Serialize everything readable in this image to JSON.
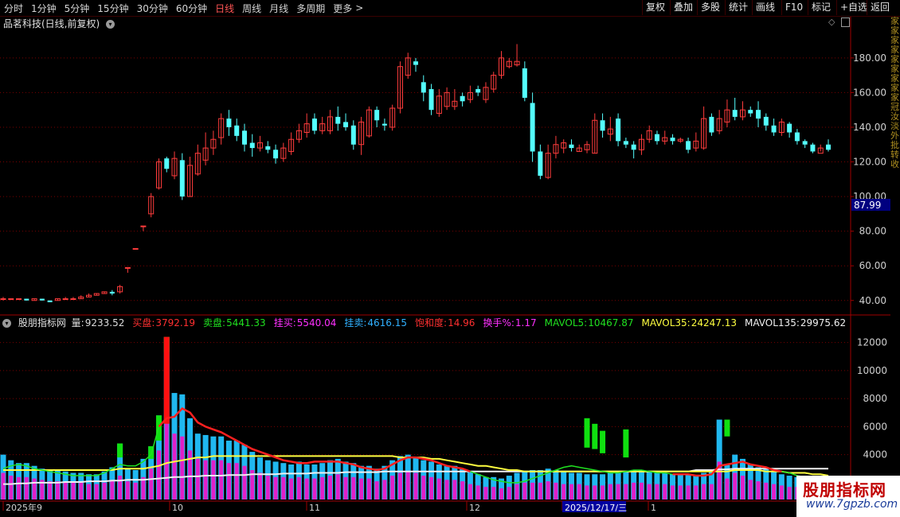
{
  "toolbar": {
    "periods": [
      {
        "label": "分时",
        "active": false
      },
      {
        "label": "1分钟",
        "active": false
      },
      {
        "label": "5分钟",
        "active": false
      },
      {
        "label": "15分钟",
        "active": false
      },
      {
        "label": "30分钟",
        "active": false
      },
      {
        "label": "60分钟",
        "active": false
      },
      {
        "label": "日线",
        "active": true
      },
      {
        "label": "周线",
        "active": false
      },
      {
        "label": "月线",
        "active": false
      },
      {
        "label": "多周期",
        "active": false
      },
      {
        "label": "更多",
        "active": false
      }
    ],
    "more_arrow": ">",
    "right_buttons": [
      "复权",
      "叠加",
      "多股",
      "统计",
      "画线",
      "F10",
      "标记",
      "+自选",
      "返回"
    ]
  },
  "chart_title": "品茗科技(日线,前复权)",
  "price_axis": {
    "ticks": [
      180,
      160,
      140,
      120,
      100,
      80,
      60,
      40
    ],
    "current_label": "87.99",
    "ylim": [
      33,
      196
    ]
  },
  "volume_axis": {
    "ticks": [
      12000,
      10000,
      8000,
      6000,
      4000,
      2000
    ],
    "ylim": [
      800,
      13000
    ]
  },
  "volume_header": {
    "name": "股朋指标网",
    "items": [
      {
        "label": "量:",
        "value": "9233.52",
        "color": "#dcdcdc"
      },
      {
        "label": "买盘:",
        "value": "3792.19",
        "color": "#ff3030"
      },
      {
        "label": "卖盘:",
        "value": "5441.33",
        "color": "#20e020"
      },
      {
        "label": "挂买:",
        "value": "5540.04",
        "color": "#ff30ff"
      },
      {
        "label": "挂卖:",
        "value": "4616.15",
        "color": "#30b0ff"
      },
      {
        "label": "饱和度:",
        "value": "14.96",
        "color": "#ff3030"
      },
      {
        "label": "换手%:",
        "value": "1.17",
        "color": "#ff30ff"
      },
      {
        "label": "MAVOL5:",
        "value": "10467.87",
        "color": "#20e020"
      },
      {
        "label": "MAVOL35:",
        "value": "24247.13",
        "color": "#ffff40"
      },
      {
        "label": "MAVOL135:",
        "value": "29975.62",
        "color": "#f0f0f0"
      }
    ]
  },
  "date_axis": [
    {
      "label": "2025年9",
      "highlight": false
    },
    {
      "label": "10",
      "highlight": false
    },
    {
      "label": "11",
      "highlight": false
    },
    {
      "label": "12",
      "highlight": false
    },
    {
      "label": "2025/12/17/三",
      "highlight": true
    },
    {
      "label": "1",
      "highlight": false
    }
  ],
  "watermark": {
    "title": "股朋指标网",
    "url": "www.7gpzb.com"
  },
  "colors": {
    "up": "#ff3c3c",
    "down": "#54ffff",
    "grid": "#7a0000",
    "ma5": "#20e020",
    "ma35": "#ffff40",
    "ma135": "#f0f0f0",
    "buy": "#ff1010",
    "sell": "#10e010",
    "magenta": "#e020c8",
    "cyan": "#20b8f0"
  },
  "chart_data": {
    "type": "candlestick",
    "price_candles": [
      [
        41,
        41,
        40,
        42
      ],
      [
        41,
        41,
        41,
        41
      ],
      [
        41,
        41,
        41,
        41
      ],
      [
        41,
        40,
        40,
        41
      ],
      [
        40,
        41,
        40,
        41
      ],
      [
        41,
        40,
        40,
        41
      ],
      [
        40,
        39,
        39,
        40
      ],
      [
        40,
        41,
        40,
        41
      ],
      [
        41,
        41,
        41,
        42
      ],
      [
        41,
        41,
        41,
        42
      ],
      [
        41,
        42,
        41,
        43
      ],
      [
        42,
        43,
        42,
        44
      ],
      [
        43,
        44,
        43,
        44
      ],
      [
        44,
        45,
        44,
        45
      ],
      [
        45,
        44,
        43,
        46
      ],
      [
        45,
        48,
        44,
        49
      ],
      [
        59,
        59,
        56,
        59
      ],
      [
        70,
        70,
        70,
        70
      ],
      [
        83,
        83,
        80,
        83
      ],
      [
        90,
        100,
        88,
        102
      ],
      [
        105,
        120,
        104,
        122
      ],
      [
        122,
        116,
        114,
        123
      ],
      [
        112,
        122,
        110,
        126
      ],
      [
        121,
        100,
        98,
        125
      ],
      [
        100,
        118,
        100,
        123
      ],
      [
        113,
        125,
        112,
        130
      ],
      [
        121,
        128,
        118,
        137
      ],
      [
        128,
        133,
        124,
        138
      ],
      [
        134,
        145,
        130,
        148
      ],
      [
        145,
        140,
        135,
        150
      ],
      [
        141,
        135,
        132,
        145
      ],
      [
        138,
        130,
        126,
        142
      ],
      [
        131,
        128,
        123,
        136
      ],
      [
        128,
        131,
        126,
        135
      ],
      [
        129,
        127,
        125,
        132
      ],
      [
        127,
        122,
        119,
        130
      ],
      [
        122,
        128,
        120,
        131
      ],
      [
        126,
        133,
        124,
        137
      ],
      [
        133,
        138,
        131,
        142
      ],
      [
        137,
        142,
        134,
        148
      ],
      [
        145,
        138,
        136,
        148
      ],
      [
        138,
        142,
        136,
        146
      ],
      [
        138,
        146,
        136,
        150
      ],
      [
        146,
        142,
        138,
        152
      ],
      [
        143,
        140,
        138,
        148
      ],
      [
        141,
        130,
        127,
        144
      ],
      [
        130,
        143,
        124,
        146
      ],
      [
        135,
        150,
        134,
        152
      ],
      [
        150,
        144,
        140,
        152
      ],
      [
        142,
        141,
        138,
        145
      ],
      [
        140,
        151,
        138,
        153
      ],
      [
        151,
        175,
        148,
        178
      ],
      [
        170,
        180,
        168,
        183
      ],
      [
        178,
        176,
        172,
        180
      ],
      [
        166,
        160,
        155,
        170
      ],
      [
        162,
        150,
        147,
        165
      ],
      [
        148,
        158,
        146,
        162
      ],
      [
        152,
        160,
        150,
        163
      ],
      [
        152,
        155,
        150,
        162
      ],
      [
        158,
        155,
        152,
        160
      ],
      [
        156,
        160,
        154,
        164
      ],
      [
        162,
        160,
        158,
        164
      ],
      [
        156,
        163,
        154,
        166
      ],
      [
        162,
        170,
        160,
        172
      ],
      [
        170,
        180,
        168,
        184
      ],
      [
        175,
        178,
        174,
        180
      ],
      [
        176,
        178,
        175,
        188
      ],
      [
        174,
        157,
        155,
        178
      ],
      [
        154,
        126,
        120,
        160
      ],
      [
        126,
        112,
        110,
        130
      ],
      [
        111,
        125,
        110,
        130
      ],
      [
        125,
        130,
        122,
        135
      ],
      [
        128,
        131,
        125,
        133
      ],
      [
        130,
        128,
        126,
        133
      ],
      [
        126,
        128,
        126,
        130
      ],
      [
        127,
        130,
        125,
        132
      ],
      [
        125,
        144,
        125,
        148
      ],
      [
        144,
        138,
        134,
        148
      ],
      [
        136,
        139,
        132,
        146
      ],
      [
        145,
        132,
        129,
        148
      ],
      [
        132,
        130,
        128,
        134
      ],
      [
        130,
        127,
        122,
        132
      ],
      [
        127,
        133,
        124,
        136
      ],
      [
        133,
        138,
        131,
        141
      ],
      [
        136,
        132,
        130,
        138
      ],
      [
        132,
        134,
        130,
        138
      ],
      [
        134,
        132,
        130,
        136
      ],
      [
        132,
        133,
        131,
        134
      ],
      [
        132,
        127,
        125,
        134
      ],
      [
        128,
        132,
        126,
        137
      ],
      [
        128,
        145,
        127,
        152
      ],
      [
        146,
        137,
        135,
        148
      ],
      [
        138,
        145,
        136,
        150
      ],
      [
        143,
        150,
        140,
        156
      ],
      [
        150,
        146,
        144,
        157
      ],
      [
        146,
        150,
        144,
        155
      ],
      [
        150,
        148,
        146,
        152
      ],
      [
        150,
        145,
        140,
        155
      ],
      [
        146,
        141,
        138,
        148
      ],
      [
        141,
        137,
        135,
        145
      ],
      [
        137,
        143,
        135,
        145
      ],
      [
        142,
        137,
        134,
        143
      ],
      [
        137,
        132,
        130,
        139
      ],
      [
        132,
        130,
        128,
        133
      ],
      [
        130,
        126,
        125,
        131
      ],
      [
        125,
        128,
        126,
        130
      ],
      [
        130,
        127,
        126,
        133
      ]
    ],
    "volume_bars": {
      "totals": [
        4000,
        3600,
        3400,
        3400,
        3200,
        3000,
        2900,
        2900,
        2800,
        2700,
        2700,
        2600,
        2600,
        2800,
        3100,
        4800,
        3000,
        2900,
        3700,
        4600,
        6800,
        12400,
        8400,
        8300,
        6600,
        5500,
        5400,
        5300,
        5300,
        5000,
        5000,
        4700,
        4200,
        3800,
        3600,
        3500,
        3400,
        3300,
        3500,
        3300,
        3300,
        3400,
        3600,
        3700,
        3500,
        3400,
        3200,
        3200,
        3000,
        3200,
        3600,
        3900,
        4000,
        3800,
        3600,
        3500,
        3300,
        3200,
        3200,
        3000,
        2800,
        2600,
        2400,
        2400,
        2300,
        2500,
        2700,
        2800,
        2900,
        2900,
        3000,
        2900,
        2800,
        2700,
        2700,
        2600,
        2600,
        2600,
        2700,
        2800,
        2800,
        2900,
        2900,
        2800,
        2700,
        2700,
        2600,
        2600,
        2600,
        2500,
        2700,
        2800,
        6500,
        3300,
        4000,
        3700,
        3300,
        3100,
        3000,
        2800,
        2600,
        2500,
        2400,
        2300,
        2200,
        2100,
        2000
      ],
      "magenta": [
        2700,
        2500,
        2400,
        2400,
        2300,
        2200,
        2100,
        2100,
        2000,
        2000,
        2000,
        1900,
        1900,
        2000,
        2200,
        2500,
        2100,
        2000,
        2400,
        3000,
        4300,
        6200,
        5500,
        5300,
        4300,
        3700,
        3600,
        3600,
        3600,
        3400,
        3400,
        3200,
        2900,
        2700,
        2500,
        2400,
        2400,
        2300,
        2400,
        2300,
        2300,
        2400,
        2500,
        2600,
        2400,
        2400,
        2300,
        2300,
        2100,
        2200,
        2500,
        2700,
        2800,
        2700,
        2500,
        2400,
        2300,
        2200,
        2200,
        2100,
        1900,
        1800,
        1700,
        1700,
        1600,
        1700,
        1900,
        2000,
        2000,
        2000,
        2100,
        2000,
        1900,
        1900,
        1900,
        1800,
        1800,
        1800,
        1900,
        1900,
        1900,
        2000,
        2000,
        1900,
        1900,
        1900,
        1800,
        1800,
        1800,
        1800,
        1900,
        1900,
        3500,
        2300,
        2700,
        2500,
        2200,
        2100,
        2000,
        1900,
        1800,
        1700,
        1700,
        1600,
        1500,
        1500,
        1400
      ],
      "red_segments": [
        [
          0,
          0
        ],
        [
          0,
          0
        ],
        [
          0,
          0
        ],
        [
          0,
          0
        ],
        [
          0,
          0
        ],
        [
          0,
          0
        ],
        [
          0,
          0
        ],
        [
          0,
          0
        ],
        [
          0,
          0
        ],
        [
          0,
          0
        ],
        [
          0,
          0
        ],
        [
          0,
          0
        ],
        [
          0,
          0
        ],
        [
          0,
          0
        ],
        [
          0,
          0
        ],
        [
          0,
          0
        ],
        [
          0,
          0
        ],
        [
          0,
          0
        ],
        [
          0,
          0
        ],
        [
          0,
          0
        ],
        [
          0,
          0
        ],
        [
          6200,
          12400
        ],
        [
          0,
          0
        ]
      ],
      "green_top": {
        "15": [
          3800,
          4800
        ],
        "19": [
          3700,
          4600
        ],
        "20": [
          5000,
          6800
        ],
        "21": [
          11300,
          12400
        ],
        "75": [
          4500,
          6600
        ],
        "76": [
          4400,
          6200
        ],
        "77": [
          4100,
          5700
        ],
        "80": [
          3800,
          5800
        ],
        "93": [
          5300,
          6500
        ]
      }
    },
    "ma5": [
      3000,
      3200,
      3300,
      3200,
      3000,
      2900,
      2800,
      2700,
      2600,
      2500,
      2500,
      2500,
      2500,
      2700,
      3000,
      3300,
      3200,
      3200,
      3500,
      4000,
      6000,
      6600,
      6700,
      7300,
      7000,
      6300,
      6000,
      5800,
      5600,
      5300,
      5000,
      4700,
      4400,
      4200,
      4000,
      3800,
      3600,
      3500,
      3400,
      3400,
      3500,
      3500,
      3500,
      3500,
      3400,
      3300,
      3100,
      3000,
      2900,
      3000,
      3300,
      3600,
      3800,
      3800,
      3700,
      3600,
      3400,
      3200,
      3100,
      3000,
      2800,
      2600,
      2400,
      2200,
      2100,
      2000,
      2000,
      2100,
      2300,
      2500,
      2700,
      2900,
      3100,
      3200,
      3100,
      3000,
      2900,
      2800,
      2700,
      2700,
      2800,
      2900,
      2900,
      2800,
      2700,
      2700,
      2600,
      2600,
      2600,
      2500,
      2500,
      2600,
      3200,
      3300,
      3400,
      3500,
      3300,
      3200,
      3100,
      2900,
      2800,
      2700,
      2500,
      2400,
      2300,
      2200,
      2100
    ],
    "ma35": [
      2900,
      2900,
      2900,
      2900,
      2900,
      2900,
      2900,
      2900,
      2900,
      2900,
      2900,
      2900,
      2900,
      2900,
      2900,
      3000,
      3000,
      3000,
      3000,
      3100,
      3200,
      3400,
      3500,
      3600,
      3700,
      3800,
      3800,
      3900,
      3900,
      3900,
      3900,
      3900,
      3900,
      3900,
      3900,
      3900,
      3900,
      3900,
      3900,
      3900,
      3900,
      3900,
      3900,
      3900,
      3900,
      3900,
      3900,
      3900,
      3900,
      3900,
      3900,
      3800,
      3800,
      3800,
      3800,
      3700,
      3700,
      3600,
      3500,
      3400,
      3300,
      3200,
      3200,
      3100,
      3000,
      2900,
      2900,
      2800,
      2800,
      2800,
      2800,
      2800,
      2800,
      2800,
      2800,
      2800,
      2800,
      2800,
      2800,
      2800,
      2800,
      2800,
      2800,
      2800,
      2800,
      2800,
      2800,
      2800,
      2800,
      2800,
      2800,
      2800,
      2800,
      2800,
      2900,
      2900,
      2900,
      2900,
      2800,
      2800,
      2800,
      2700,
      2700,
      2700,
      2600,
      2600,
      2500
    ],
    "ma135": [
      1900,
      1900,
      1950,
      1950,
      2000,
      2000,
      2000,
      2000,
      2050,
      2050,
      2050,
      2100,
      2100,
      2100,
      2150,
      2150,
      2200,
      2200,
      2200,
      2250,
      2300,
      2350,
      2400,
      2400,
      2450,
      2450,
      2500,
      2500,
      2500,
      2550,
      2550,
      2550,
      2600,
      2600,
      2600,
      2600,
      2650,
      2650,
      2650,
      2650,
      2700,
      2700,
      2700,
      2700,
      2750,
      2750,
      2750,
      2750,
      2750,
      2800,
      2800,
      2800,
      2800,
      2800,
      2800,
      2800,
      2800,
      2800,
      2800,
      2800,
      2800,
      2800,
      2800,
      2800,
      2800,
      2800,
      2800,
      2800,
      2800,
      2800,
      2800,
      2800,
      2800,
      2800,
      2800,
      2800,
      2800,
      2800,
      2800,
      2800,
      2800,
      2800,
      2800,
      2800,
      2800,
      2800,
      2800,
      2800,
      2800,
      2900,
      2900,
      2900,
      2950,
      2950,
      3000,
      3000,
      3000,
      3000,
      3000,
      3000,
      3000,
      3000,
      3000,
      3000,
      3000,
      3000,
      3000
    ],
    "red_ma_overlay": [
      [
        20,
        60
      ],
      [
        86,
        100
      ]
    ]
  },
  "right_gutter_text": "家家家家家家家家家冠汝淡外批转收"
}
